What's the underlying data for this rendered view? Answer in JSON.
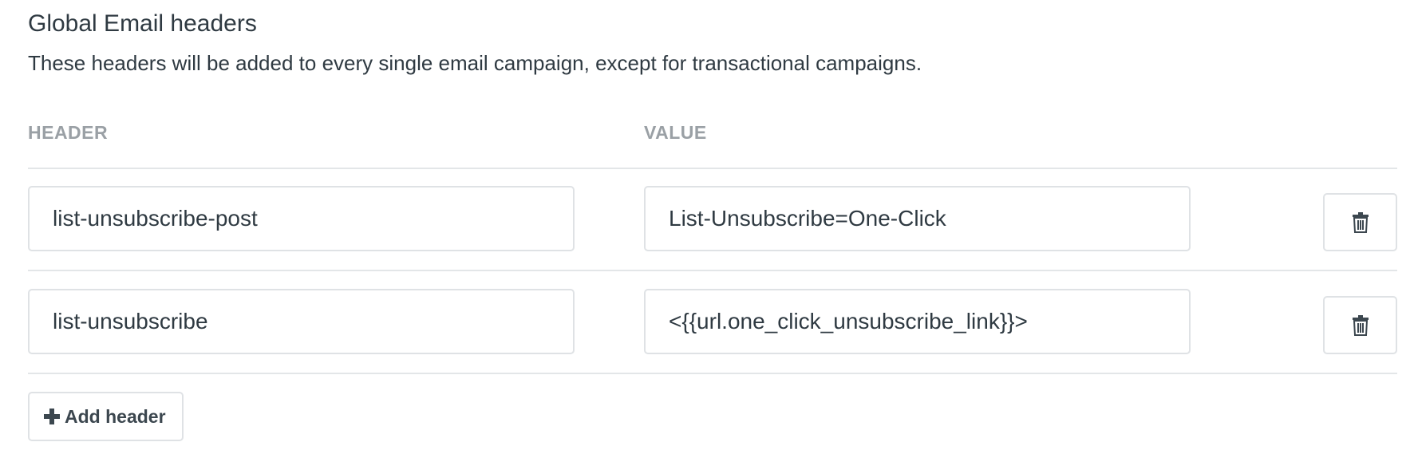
{
  "section": {
    "title": "Global Email headers",
    "description": "These headers will be added to every single email campaign, except for transactional campaigns."
  },
  "columns": {
    "header": "HEADER",
    "value": "VALUE"
  },
  "rows": [
    {
      "header": "list-unsubscribe-post",
      "value": "List-Unsubscribe=One-Click",
      "delete_icon": "trash-icon"
    },
    {
      "header": "list-unsubscribe",
      "value": "<{{url.one_click_unsubscribe_link}}>",
      "delete_icon": "trash-icon"
    }
  ],
  "add_button": {
    "icon": "plus-icon",
    "label": "Add header"
  }
}
